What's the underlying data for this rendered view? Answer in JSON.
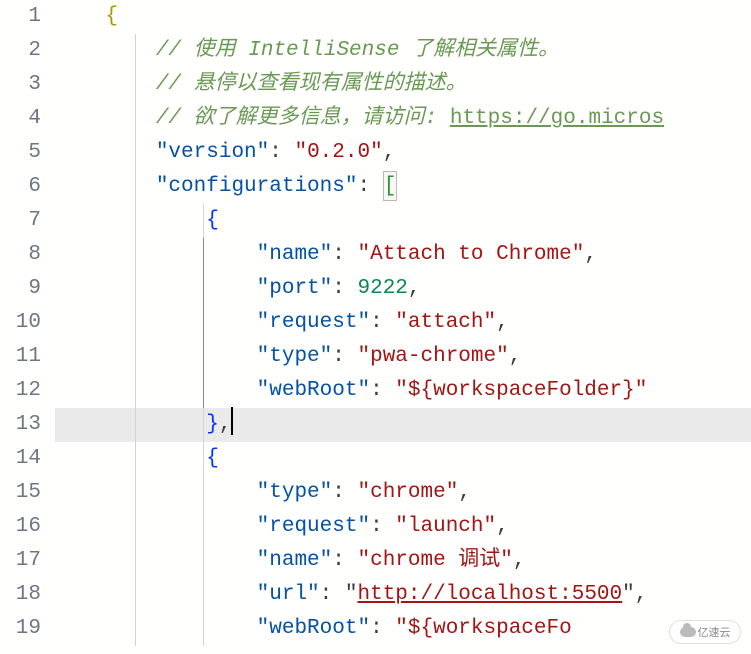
{
  "watermark": "亿速云",
  "lines": [
    {
      "n": 1,
      "indent": 0,
      "guides": [],
      "tokens": [
        [
          "indent",
          "    "
        ],
        [
          "brace-yellow",
          "{"
        ]
      ]
    },
    {
      "n": 2,
      "indent": 2,
      "guides": [
        "ig1"
      ],
      "tokens": [
        [
          "comment",
          "// 使用 IntelliSense 了解相关属性。"
        ]
      ]
    },
    {
      "n": 3,
      "indent": 2,
      "guides": [
        "ig1"
      ],
      "tokens": [
        [
          "comment",
          "// 悬停以查看现有属性的描述。"
        ]
      ]
    },
    {
      "n": 4,
      "indent": 2,
      "guides": [
        "ig1"
      ],
      "tokens": [
        [
          "comment",
          "// 欲了解更多信息，请访问: "
        ],
        [
          "url",
          "https://go.micros"
        ]
      ]
    },
    {
      "n": 5,
      "indent": 2,
      "guides": [
        "ig1"
      ],
      "tokens": [
        [
          "key",
          "\"version\""
        ],
        [
          "colon",
          ": "
        ],
        [
          "string",
          "\"0.2.0\""
        ],
        [
          "comma",
          ","
        ]
      ]
    },
    {
      "n": 6,
      "indent": 2,
      "guides": [
        "ig1"
      ],
      "tokens": [
        [
          "key",
          "\"configurations\""
        ],
        [
          "colon",
          ": "
        ],
        [
          "bracket-match",
          "["
        ]
      ]
    },
    {
      "n": 7,
      "indent": 3,
      "guides": [
        "ig1",
        "ig2"
      ],
      "tokens": [
        [
          "brace",
          "{"
        ]
      ]
    },
    {
      "n": 8,
      "indent": 4,
      "guides": [
        "ig1",
        "ig2a"
      ],
      "tokens": [
        [
          "key",
          "\"name\""
        ],
        [
          "colon",
          ": "
        ],
        [
          "string",
          "\"Attach to Chrome\""
        ],
        [
          "comma",
          ","
        ]
      ]
    },
    {
      "n": 9,
      "indent": 4,
      "guides": [
        "ig1",
        "ig2a"
      ],
      "tokens": [
        [
          "key",
          "\"port\""
        ],
        [
          "colon",
          ": "
        ],
        [
          "number",
          "9222"
        ],
        [
          "comma",
          ","
        ]
      ]
    },
    {
      "n": 10,
      "indent": 4,
      "guides": [
        "ig1",
        "ig2a"
      ],
      "tokens": [
        [
          "key",
          "\"request\""
        ],
        [
          "colon",
          ": "
        ],
        [
          "string",
          "\"attach\""
        ],
        [
          "comma",
          ","
        ]
      ]
    },
    {
      "n": 11,
      "indent": 4,
      "guides": [
        "ig1",
        "ig2a"
      ],
      "tokens": [
        [
          "key",
          "\"type\""
        ],
        [
          "colon",
          ": "
        ],
        [
          "string",
          "\"pwa-chrome\""
        ],
        [
          "comma",
          ","
        ]
      ]
    },
    {
      "n": 12,
      "indent": 4,
      "guides": [
        "ig1",
        "ig2a"
      ],
      "tokens": [
        [
          "key",
          "\"webRoot\""
        ],
        [
          "colon",
          ": "
        ],
        [
          "string",
          "\"${workspaceFolder}\""
        ]
      ]
    },
    {
      "n": 13,
      "indent": 3,
      "guides": [
        "ig1",
        "ig2"
      ],
      "active": true,
      "cursor": true,
      "tokens": [
        [
          "brace",
          "}"
        ],
        [
          "comma",
          ","
        ]
      ]
    },
    {
      "n": 14,
      "indent": 3,
      "guides": [
        "ig1",
        "ig2"
      ],
      "tokens": [
        [
          "brace",
          "{"
        ]
      ]
    },
    {
      "n": 15,
      "indent": 4,
      "guides": [
        "ig1",
        "ig2"
      ],
      "tokens": [
        [
          "key",
          "\"type\""
        ],
        [
          "colon",
          ": "
        ],
        [
          "string",
          "\"chrome\""
        ],
        [
          "comma",
          ","
        ]
      ]
    },
    {
      "n": 16,
      "indent": 4,
      "guides": [
        "ig1",
        "ig2"
      ],
      "tokens": [
        [
          "key",
          "\"request\""
        ],
        [
          "colon",
          ": "
        ],
        [
          "string",
          "\"launch\""
        ],
        [
          "comma",
          ","
        ]
      ]
    },
    {
      "n": 17,
      "indent": 4,
      "guides": [
        "ig1",
        "ig2"
      ],
      "tokens": [
        [
          "key",
          "\"name\""
        ],
        [
          "colon",
          ": "
        ],
        [
          "string",
          "\"chrome 调试\""
        ],
        [
          "comma",
          ","
        ]
      ]
    },
    {
      "n": 18,
      "indent": 4,
      "guides": [
        "ig1",
        "ig2"
      ],
      "tokens": [
        [
          "key",
          "\"url\""
        ],
        [
          "colon",
          ": "
        ],
        [
          "quote",
          "\""
        ],
        [
          "url-string",
          "http://localhost:5500"
        ],
        [
          "quote",
          "\""
        ],
        [
          "comma",
          ","
        ]
      ]
    },
    {
      "n": 19,
      "indent": 4,
      "guides": [
        "ig1",
        "ig2"
      ],
      "tokens": [
        [
          "key",
          "\"webRoot\""
        ],
        [
          "colon",
          ": "
        ],
        [
          "string",
          "\"${workspaceFo"
        ]
      ]
    }
  ],
  "indent_unit": "    ",
  "token_classes": {
    "brace": "token-brace",
    "brace-yellow": "token-brace-yellow",
    "bracket": "token-bracket",
    "bracket-match": "token-bracket bracket-match",
    "comment": "token-comment",
    "key": "token-key",
    "colon": "token-colon",
    "comma": "token-comma",
    "string": "token-string",
    "number": "token-number",
    "url": "token-url",
    "url-string": "token-url-string",
    "quote": "token-quote",
    "punc": "token-punc",
    "indent": ""
  }
}
